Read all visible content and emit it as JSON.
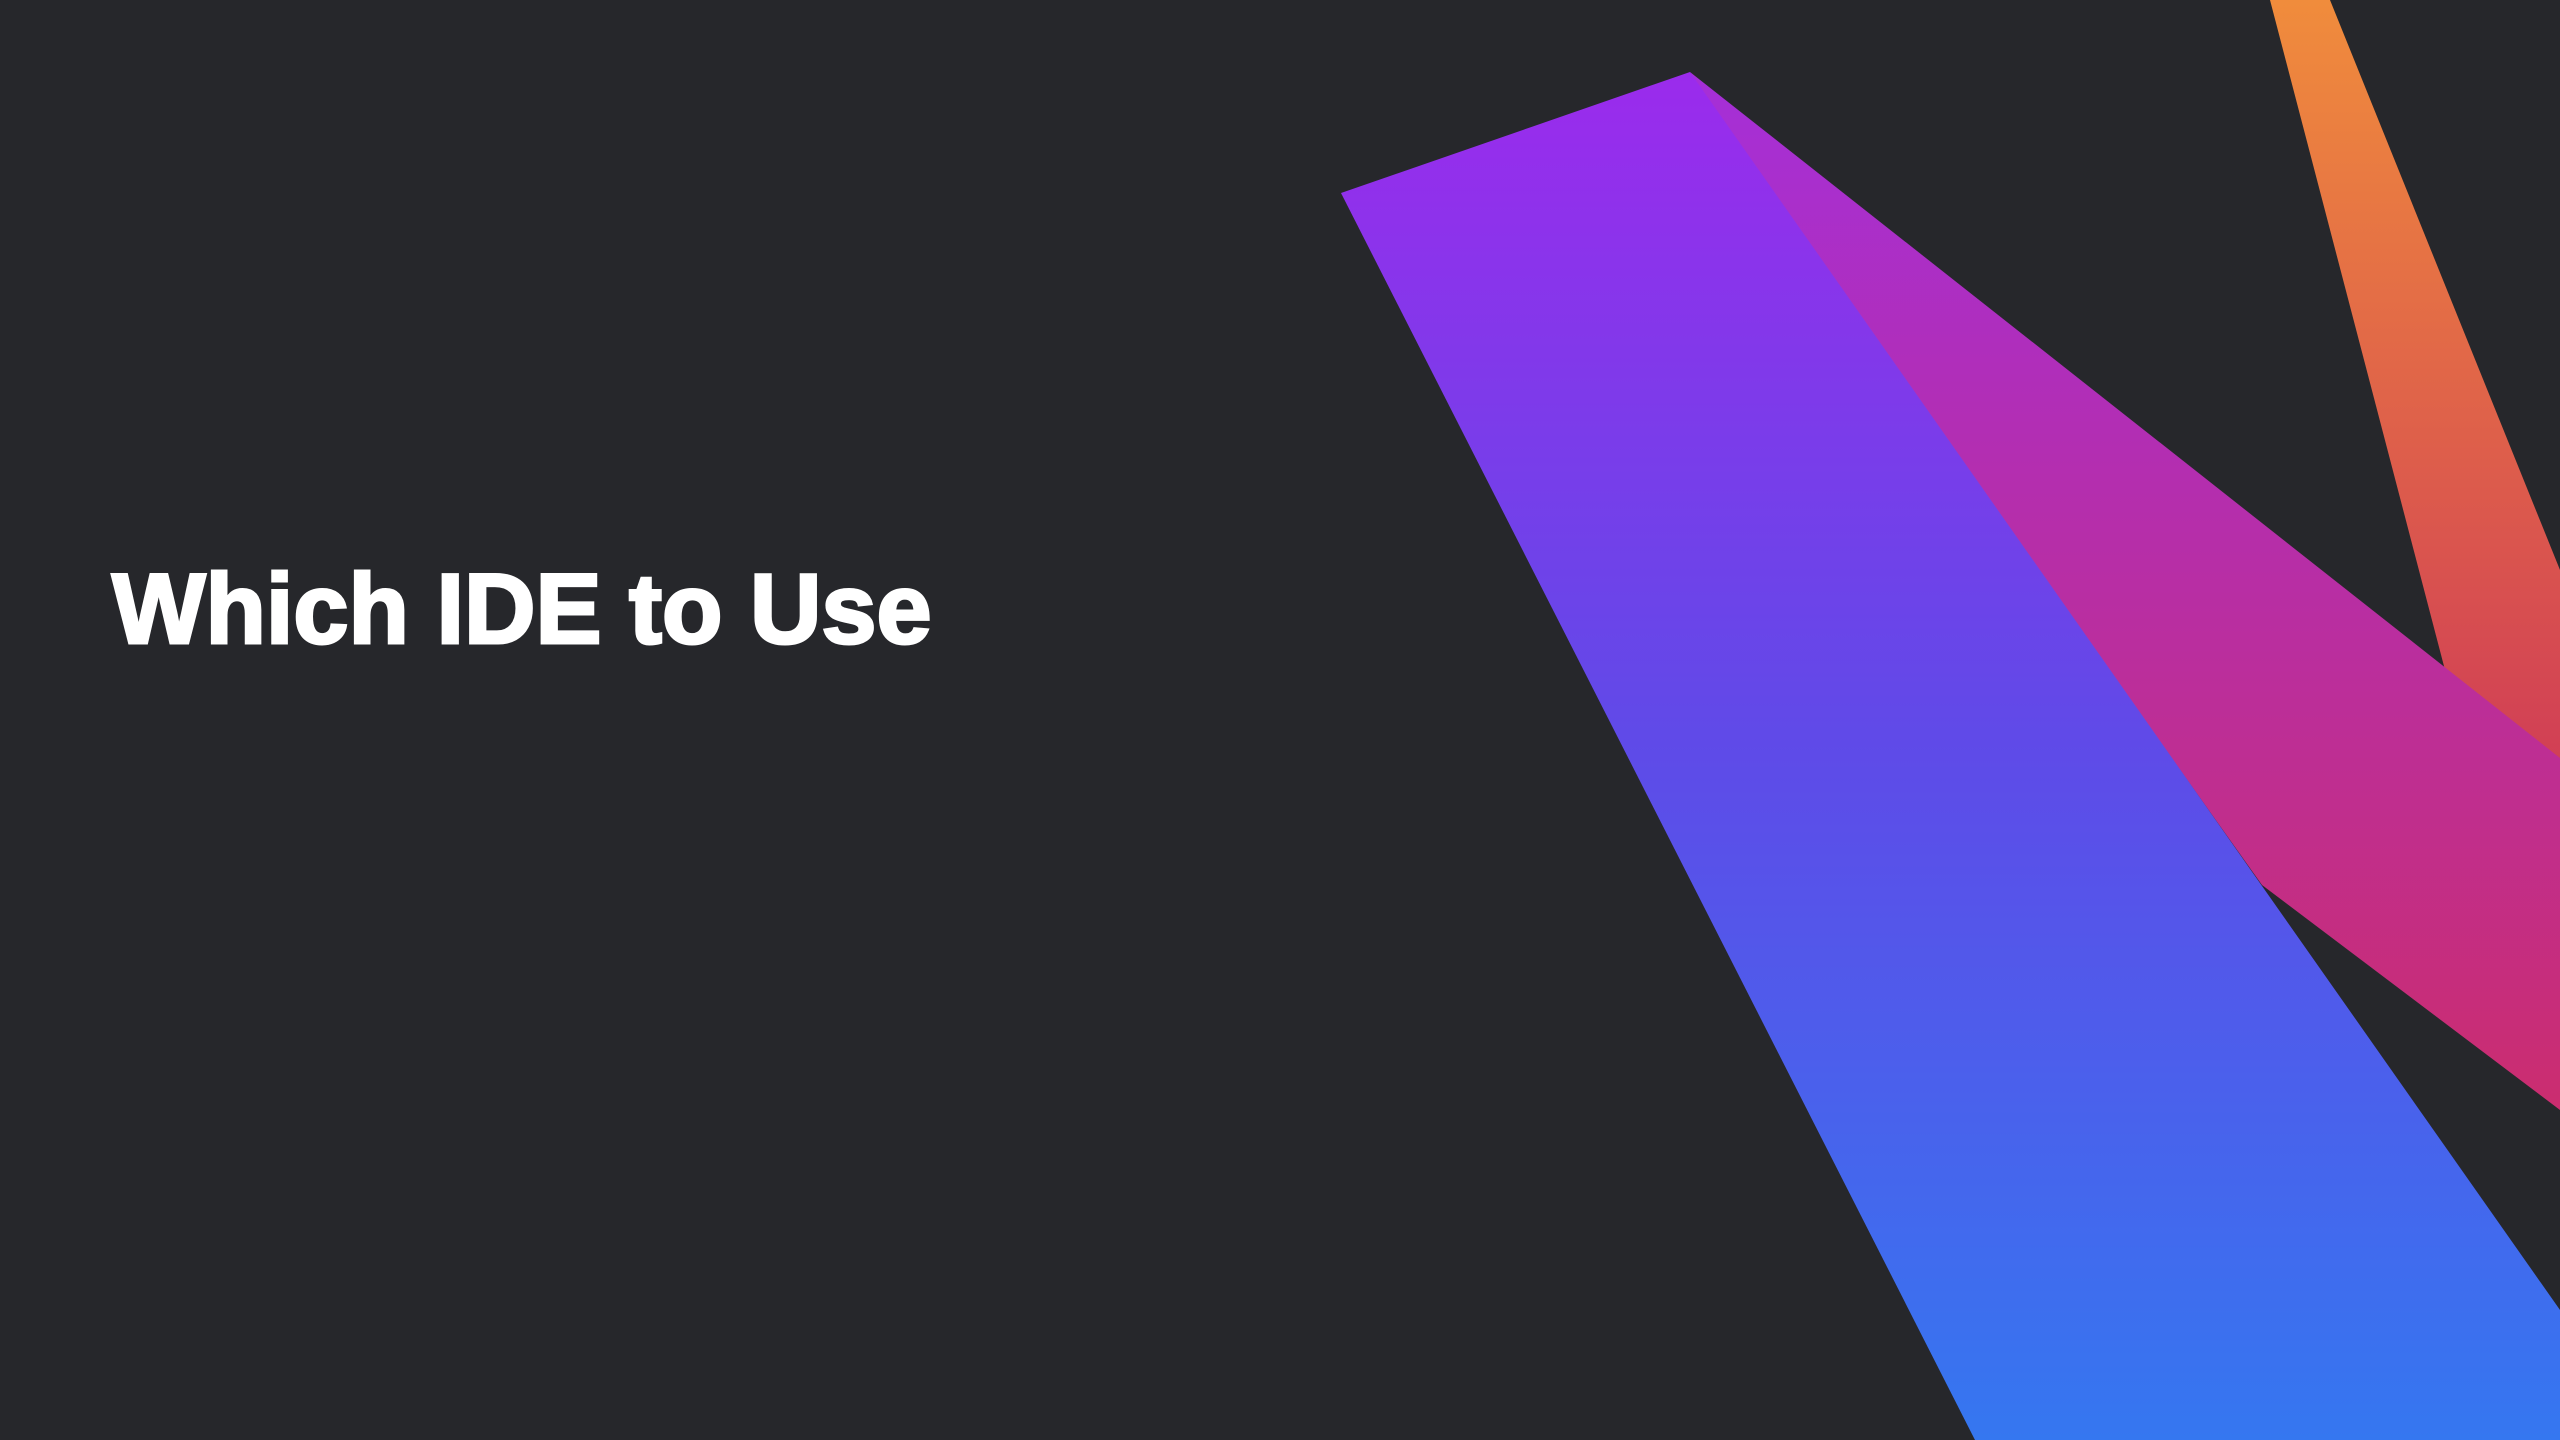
{
  "slide": {
    "title": "Which IDE to Use",
    "background_color": "#26272b",
    "title_color": "#ffffff"
  },
  "decoration": {
    "name": "kotlin-style-gradient-stripes",
    "colors": {
      "blue": "#3577f0",
      "violet": "#9b2bec",
      "magenta": "#a42fd0",
      "pink": "#cb2d6f",
      "orange": "#f08c3c",
      "red": "#d13f55"
    }
  }
}
